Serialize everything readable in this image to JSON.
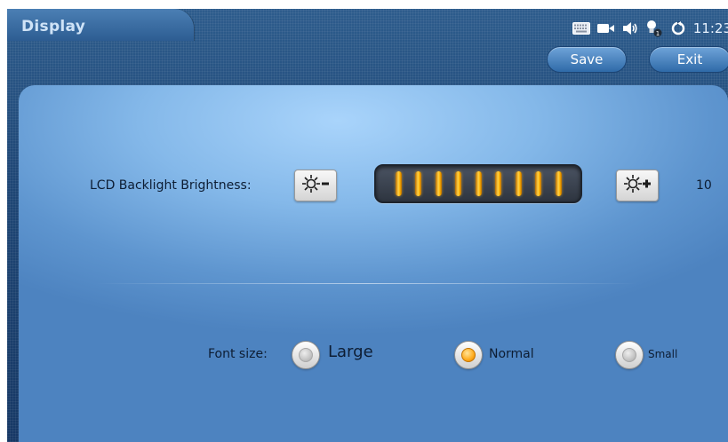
{
  "header": {
    "title": "Display",
    "time": "11:23"
  },
  "status_icons": [
    "keyboard-icon",
    "camera-icon",
    "speaker-icon",
    "lightbulb-icon",
    "sync-icon"
  ],
  "status_bulb_badge": "1",
  "toolbar": {
    "save_label": "Save",
    "exit_label": "Exit"
  },
  "brightness": {
    "label": "LCD Backlight Brightness:",
    "value": "10",
    "level": 10,
    "max": 10,
    "decrease_icon": "brightness-down-icon",
    "increase_icon": "brightness-up-icon"
  },
  "font_size": {
    "label": "Font size:",
    "options": [
      {
        "label": "Large",
        "selected": false
      },
      {
        "label": "Normal",
        "selected": true
      },
      {
        "label": "Small",
        "selected": false
      }
    ]
  },
  "colors": {
    "accent": "#ffb300",
    "panel": "#84b8e9",
    "header": "#1e4675"
  }
}
